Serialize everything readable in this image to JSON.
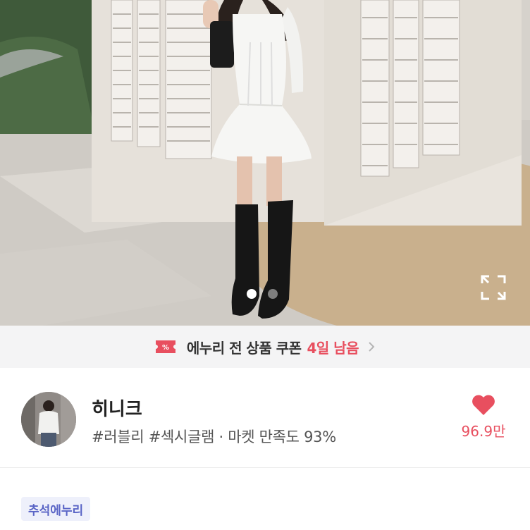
{
  "hero": {
    "image_alt": "Product photo",
    "carousel_total": 2,
    "carousel_active": 1
  },
  "coupon": {
    "text": "에누리 전 상품 쿠폰",
    "days": "4일 남음",
    "icon": "coupon-ticket-icon",
    "accent_color": "#e84f5f"
  },
  "shop": {
    "name": "히니크",
    "tags": "#러블리 #섹시글램 · 마켓 만족도 93%",
    "likes": "96.9만",
    "like_icon": "heart-icon"
  },
  "chip": {
    "label": "추석에누리"
  }
}
